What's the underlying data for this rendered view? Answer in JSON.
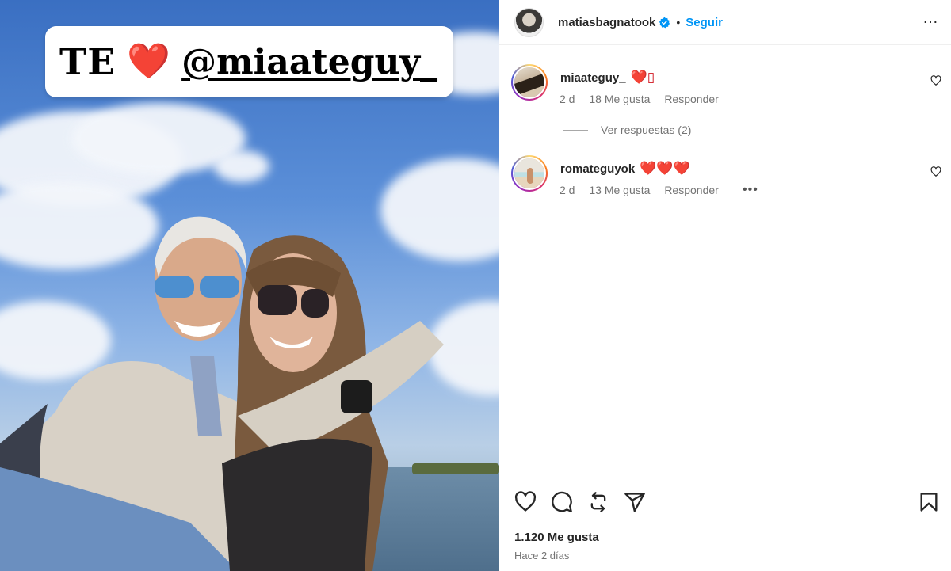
{
  "colors": {
    "accent": "#0095f6",
    "heart": "#e0151f",
    "text": "#262626",
    "muted": "#737373"
  },
  "post": {
    "sticker": {
      "te": "TE",
      "heart_icon": "heart-emoji",
      "mention": "@miaateguy_"
    }
  },
  "header": {
    "username": "matiasbagnatook",
    "verified_icon": "verified-badge-icon",
    "dot": "•",
    "follow_label": "Seguir",
    "more_icon": "…"
  },
  "comments": [
    {
      "username": "miaateguy_",
      "emoji": "❤️▯",
      "age": "2 d",
      "likes": "18 Me gusta",
      "reply_label": "Responder"
    },
    {
      "username": "romateguyok",
      "emoji": "❤️❤️❤️",
      "age": "2 d",
      "likes": "13 Me gusta",
      "reply_label": "Responder"
    }
  ],
  "view_replies": "Ver respuestas (2)",
  "actions": {
    "like_icon": "heart-outline-icon",
    "comment_icon": "comment-icon",
    "repost_icon": "repost-icon",
    "share_icon": "send-icon",
    "save_icon": "bookmark-icon"
  },
  "likes_count": "1.120 Me gusta",
  "time_ago": "Hace 2 días"
}
